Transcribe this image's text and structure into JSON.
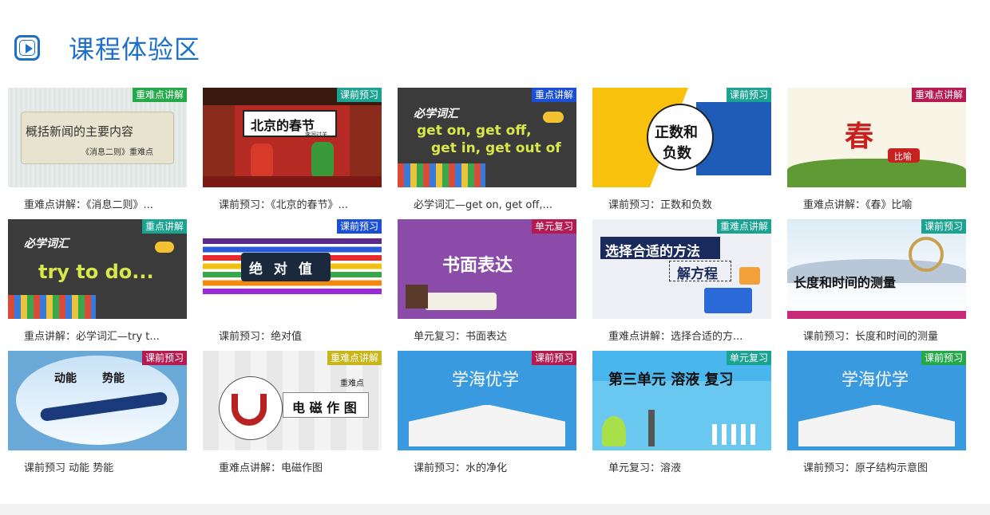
{
  "header": {
    "title": "课程体验区",
    "icon": "play-video-icon"
  },
  "badge_colors": {
    "重点讲解": "#1a5bd6",
    "课前预习": "#16a08f",
    "重难点讲解": "#b51a50",
    "单元复习": "#b51a50"
  },
  "cards": [
    {
      "badge": "重难点讲解",
      "badge_color": "#25a84a",
      "caption": "重难点讲解：《消息二则》...",
      "thumb_title": "概括新闻的主要内容",
      "thumb_sub": "《消息二则》重难点"
    },
    {
      "badge": "课前预习",
      "badge_color": "#1aa391",
      "caption": "课前预习：《北京的春节》...",
      "thumb_title": "北京的春节",
      "thumb_sub": "李润过关"
    },
    {
      "badge": "重点讲解",
      "badge_color": "#1a4fd6",
      "caption": "必学词汇—get on, get off,...",
      "thumb_title": "必学词汇",
      "thumb_sub": "get on, get off,",
      "thumb_sub2": "get in, get out of"
    },
    {
      "badge": "课前预习",
      "badge_color": "#1aa391",
      "caption": "课前预习：正数和负数",
      "thumb_title": "正数和",
      "thumb_sub": "负数"
    },
    {
      "badge": "重难点讲解",
      "badge_color": "#b51a50",
      "caption": "重难点讲解：《春》比喻",
      "thumb_title": "春",
      "thumb_sub": "比喻"
    },
    {
      "badge": "重点讲解",
      "badge_color": "#1aa391",
      "caption": "重点讲解：必学词汇—try t...",
      "thumb_title": "必学词汇",
      "thumb_sub": "try to do..."
    },
    {
      "badge": "课前预习",
      "badge_color": "#1a4fd6",
      "caption": "课前预习：绝对值",
      "thumb_title": "绝 对 值"
    },
    {
      "badge": "单元复习",
      "badge_color": "#b51a50",
      "caption": "单元复习：书面表达",
      "thumb_title": "书面表达"
    },
    {
      "badge": "重难点讲解",
      "badge_color": "#1aa391",
      "caption": "重难点讲解：选择合适的方...",
      "thumb_title": "选择合适的方法",
      "thumb_sub": "解方程"
    },
    {
      "badge": "课前预习",
      "badge_color": "#1aa391",
      "caption": "课前预习：长度和时间的测量",
      "thumb_title": "长度和时间的测量"
    },
    {
      "badge": "课前预习",
      "badge_color": "#b51a50",
      "caption": "课前预习 动能 势能",
      "thumb_title": "动能",
      "thumb_sub": "势能"
    },
    {
      "badge": "重难点讲解",
      "badge_color": "#c8b51a",
      "caption": "重难点讲解：电磁作图",
      "thumb_title": "电 磁 作 图",
      "thumb_sub": "重难点"
    },
    {
      "badge": "课前预习",
      "badge_color": "#b51a50",
      "caption": "课前预习：水的净化",
      "thumb_title": "学海优学"
    },
    {
      "badge": "单元复习",
      "badge_color": "#1aa391",
      "caption": "单元复习：溶液",
      "thumb_title": "第三单元 溶液 复习"
    },
    {
      "badge": "课前预习",
      "badge_color": "#25a84a",
      "caption": "课前预习：原子结构示意图",
      "thumb_title": "学海优学"
    }
  ]
}
